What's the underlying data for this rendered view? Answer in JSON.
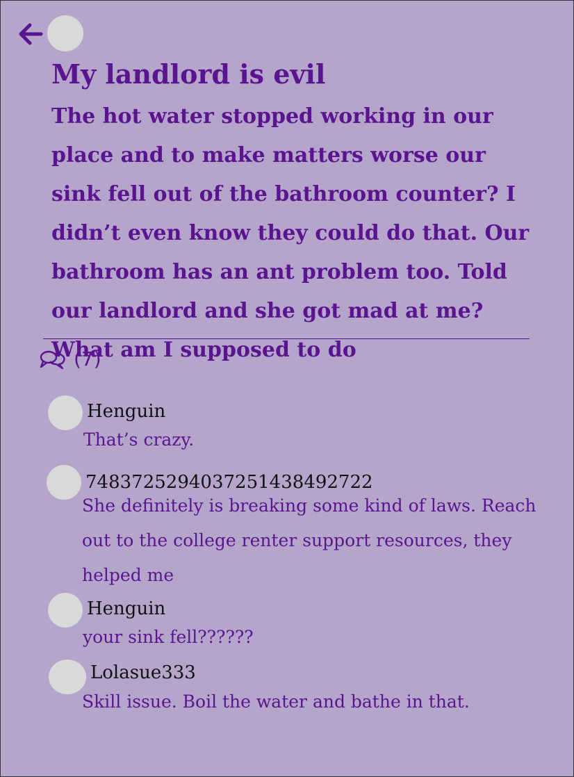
{
  "post": {
    "title": "My landlord is evil",
    "body": "The hot water stopped working in our place and to make matters worse our sink fell out of the bathroom counter? I didn’t even know they could do that. Our bathroom has an ant problem too. Told our landlord and she got mad at me? What am I supposed to do",
    "comment_count": "(7)"
  },
  "icons": {
    "back": "arrow-left-icon",
    "comments": "chat-bubbles-icon"
  },
  "colors": {
    "background": "#b5a5cb",
    "accent": "#5b1490",
    "avatar": "#d9d9d9"
  },
  "comments": [
    {
      "user": "Henguin",
      "text": "That’s crazy."
    },
    {
      "user": "7483725294037251438492722",
      "text": "She definitely is breaking some kind of laws. Reach out to the college renter support resources, they helped me"
    },
    {
      "user": "Henguin",
      "text": "your sink fell??????"
    },
    {
      "user": "Lolasue333",
      "text": "Skill issue. Boil the water and bathe in that."
    }
  ]
}
